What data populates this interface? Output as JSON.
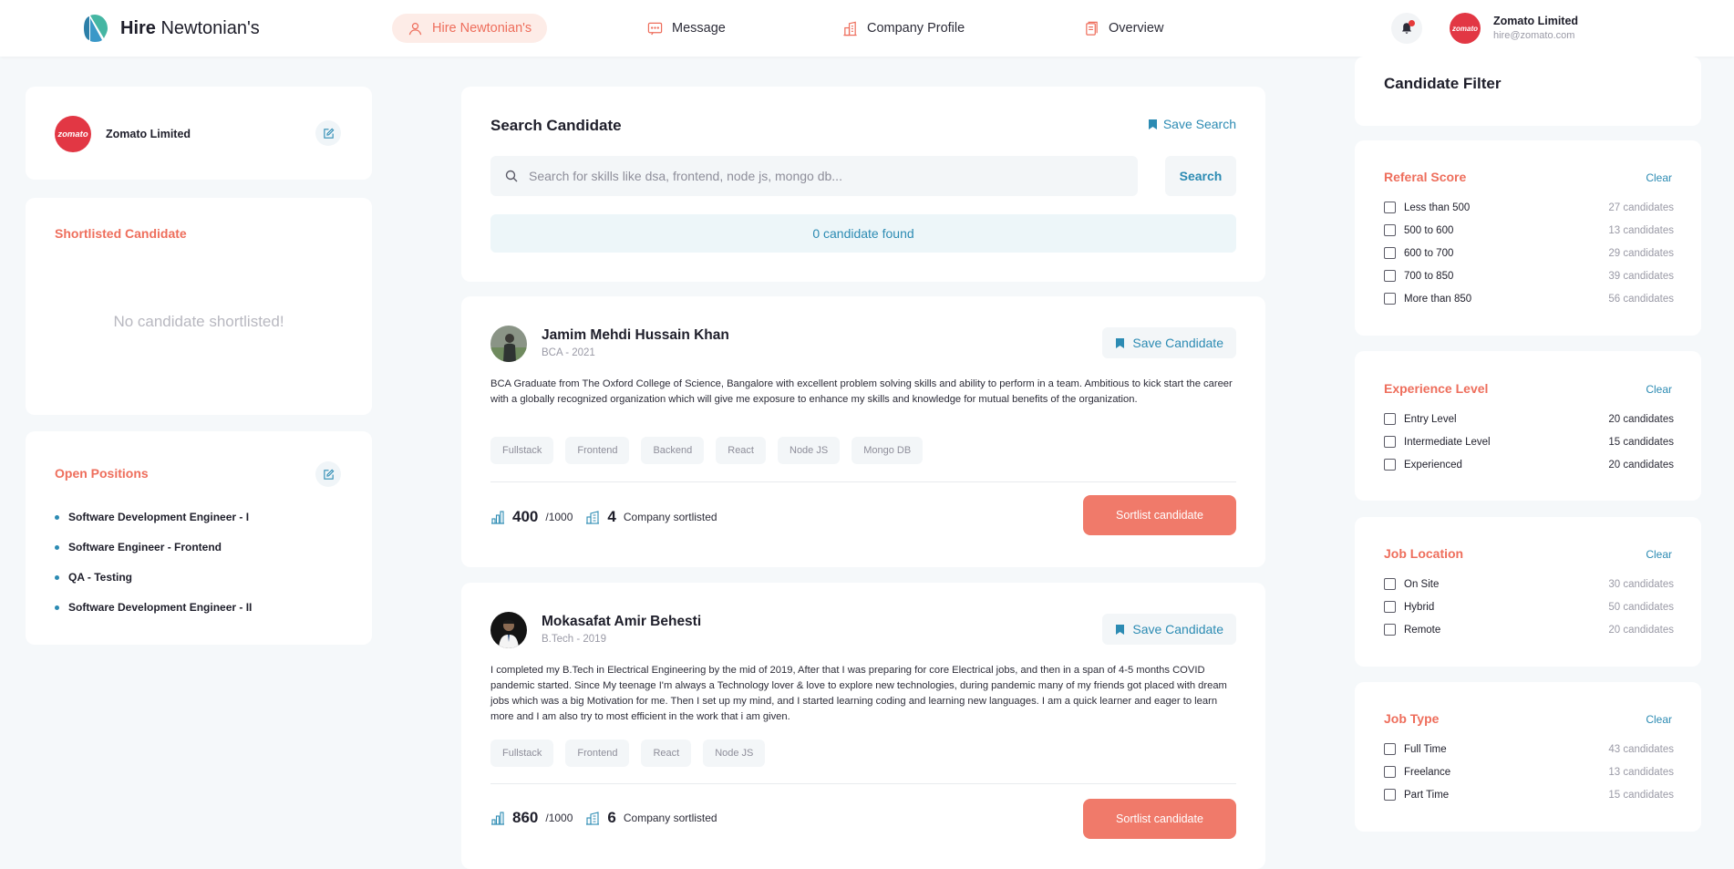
{
  "brand": {
    "name_bold": "Hire",
    "name_rest": "Newtonian's"
  },
  "nav": [
    {
      "label": "Hire Newtonian's",
      "icon": "user-icon",
      "active": true
    },
    {
      "label": "Message",
      "icon": "message-icon",
      "active": false
    },
    {
      "label": "Company Profile",
      "icon": "buildings-icon",
      "active": false
    },
    {
      "label": "Overview",
      "icon": "document-icon",
      "active": false
    }
  ],
  "user": {
    "company": "Zomato Limited",
    "email": "hire@zomato.com",
    "avatar_text": "zomato"
  },
  "company_card": {
    "name": "Zomato Limited",
    "avatar_text": "zomato"
  },
  "shortlisted": {
    "title": "Shortlisted Candidate",
    "empty": "No candidate shortlisted!"
  },
  "open_positions": {
    "title": "Open Positions",
    "items": [
      "Software Development Engineer - I",
      "Software Engineer - Frontend",
      "QA - Testing",
      "Software Development Engineer - II"
    ]
  },
  "search": {
    "title": "Search Candidate",
    "save_label": "Save Search",
    "placeholder": "Search for skills like dsa, frontend, node js, mongo db...",
    "button": "Search",
    "found": "0 candidate found"
  },
  "candidates": [
    {
      "name": "Jamim Mehdi Hussain Khan",
      "sub": "BCA - 2021",
      "save_label": "Save Candidate",
      "desc": "BCA Graduate from The Oxford College of Science, Bangalore with excellent problem solving skills and ability to perform in a team. Ambitious to kick start the career with a globally recognized organization which will give me exposure to enhance my skills and knowledge for mutual benefits of the organization.",
      "tags": [
        "Fullstack",
        "Frontend",
        "Backend",
        "React",
        "Node JS",
        "Mongo DB"
      ],
      "score": "400",
      "score_max": "/1000",
      "companies": "4",
      "companies_label": "Company sortlisted",
      "button": "Sortlist candidate"
    },
    {
      "name": "Mokasafat Amir Behesti",
      "sub": "B.Tech - 2019",
      "save_label": "Save Candidate",
      "desc": "I completed my B.Tech in Electrical Engineering by the mid of 2019, After that I was preparing for core Electrical jobs, and then in a span of 4-5 months COVID pandemic started. Since My teenage I'm always a Technology lover & love to explore new technologies, during pandemic many of my friends got placed with dream jobs which was a big Motivation for me. Then I set up my mind, and I started learning coding and learning new languages. I am a quick learner and eager to learn more and I am also try to most efficient in the work that i am given.",
      "tags": [
        "Fullstack",
        "Frontend",
        "React",
        "Node JS"
      ],
      "score": "860",
      "score_max": "/1000",
      "companies": "6",
      "companies_label": "Company sortlisted",
      "button": "Sortlist candidate"
    }
  ],
  "filters": {
    "partial_title": "Candidate Filter",
    "clear_label": "Clear",
    "groups": [
      {
        "title": "Referal Score",
        "options": [
          {
            "label": "Less than 500",
            "count": "27 candidates"
          },
          {
            "label": "500 to 600",
            "count": "13 candidates"
          },
          {
            "label": "600 to 700",
            "count": "29 candidates"
          },
          {
            "label": "700 to 850",
            "count": "39 candidates"
          },
          {
            "label": "More than 850",
            "count": "56 candidates"
          }
        ]
      },
      {
        "title": "Experience Level",
        "options": [
          {
            "label": "Entry Level",
            "count": "20 candidates"
          },
          {
            "label": "Intermediate Level",
            "count": "15 candidates"
          },
          {
            "label": "Experienced",
            "count": "20 candidates"
          }
        ]
      },
      {
        "title": "Job Location",
        "options": [
          {
            "label": "On Site",
            "count": "30 candidates"
          },
          {
            "label": "Hybrid",
            "count": "50 candidates"
          },
          {
            "label": "Remote",
            "count": "20 candidates"
          }
        ]
      },
      {
        "title": "Job Type",
        "options": [
          {
            "label": "Full Time",
            "count": "43 candidates"
          },
          {
            "label": "Freelance",
            "count": "13 candidates"
          },
          {
            "label": "Part Time",
            "count": "15 candidates"
          }
        ]
      }
    ]
  },
  "colors": {
    "accent": "#ee6e5c",
    "link": "#2c8bb3",
    "button": "#f07a6a",
    "brand_red": "#e23744"
  }
}
